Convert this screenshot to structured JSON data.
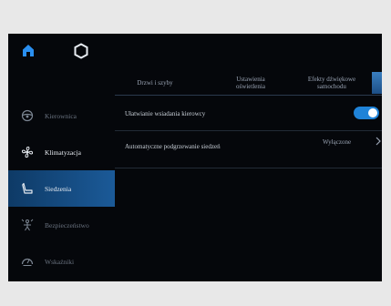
{
  "topbar": {
    "home_icon": "home-icon",
    "app_icon": "hexagon-icon"
  },
  "tabs": [
    {
      "label": "Drzwi i szyby"
    },
    {
      "label": "Ustawienia oświetlenia"
    },
    {
      "label": "Efekty dźwiękowe samochodu"
    }
  ],
  "sidebar": {
    "items": [
      {
        "label": "Kierownica",
        "icon": "steering-wheel-icon"
      },
      {
        "label": "Klimatyzacja",
        "icon": "fan-icon"
      },
      {
        "label": "Siedzenia",
        "icon": "seat-icon",
        "active": true
      },
      {
        "label": "Bezpieczeństwo",
        "icon": "safety-icon"
      },
      {
        "label": "Wskaźniki",
        "icon": "gauge-icon"
      }
    ]
  },
  "settings": {
    "easy_entry": {
      "label": "Ułatwianie wsiadania kierowcy",
      "toggle_on": true
    },
    "seat_heating": {
      "label": "Automatyczne podgrzewanie siedzeń",
      "value": "Wyłączone"
    }
  },
  "colors": {
    "accent": "#1f83d8",
    "background": "#05070b",
    "active_item": "#1b5a98"
  }
}
